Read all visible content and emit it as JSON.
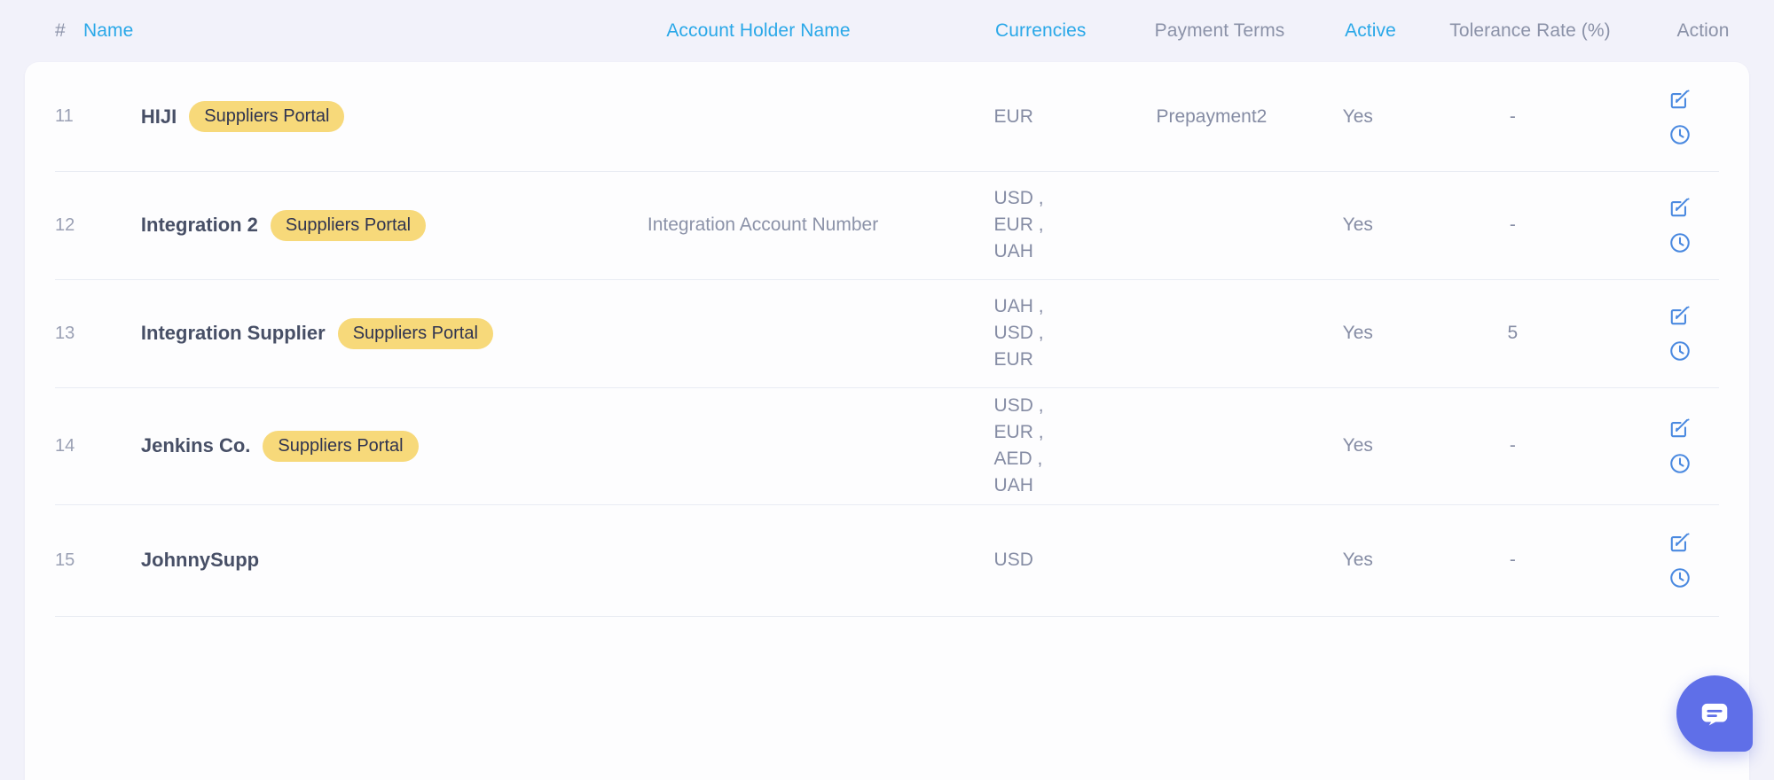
{
  "table": {
    "columns": [
      {
        "key": "num",
        "label": "#",
        "sortable": false
      },
      {
        "key": "name",
        "label": "Name",
        "sortable": true
      },
      {
        "key": "holder",
        "label": "Account Holder Name",
        "sortable": true
      },
      {
        "key": "curr",
        "label": "Currencies",
        "sortable": true
      },
      {
        "key": "terms",
        "label": "Payment Terms",
        "sortable": false
      },
      {
        "key": "active",
        "label": "Active",
        "sortable": true
      },
      {
        "key": "tol",
        "label": "Tolerance Rate (%)",
        "sortable": false
      },
      {
        "key": "action",
        "label": "Action",
        "sortable": false
      }
    ],
    "rows": [
      {
        "num": "11",
        "name": "HIJI",
        "badge": "Suppliers Portal",
        "holder": "",
        "currencies": "EUR",
        "terms": "Prepayment2",
        "active": "Yes",
        "tolerance": "-"
      },
      {
        "num": "12",
        "name": "Integration 2",
        "badge": "Suppliers Portal",
        "holder": "Integration Account Number",
        "currencies": "USD ,\nEUR ,\nUAH",
        "terms": "",
        "active": "Yes",
        "tolerance": "-"
      },
      {
        "num": "13",
        "name": "Integration Supplier",
        "badge": "Suppliers Portal",
        "holder": "",
        "currencies": "UAH ,\nUSD ,\nEUR",
        "terms": "",
        "active": "Yes",
        "tolerance": "5"
      },
      {
        "num": "14",
        "name": "Jenkins Co.",
        "badge": "Suppliers Portal",
        "holder": "",
        "currencies": "USD ,\nEUR ,\nAED ,\nUAH",
        "terms": "",
        "active": "Yes",
        "tolerance": "-"
      },
      {
        "num": "15",
        "name": "JohnnySupp",
        "badge": "",
        "holder": "",
        "currencies": "USD",
        "terms": "",
        "active": "Yes",
        "tolerance": "-"
      }
    ],
    "action_icons": [
      {
        "name": "edit-icon",
        "title": "Edit"
      },
      {
        "name": "history-clock-icon",
        "title": "History"
      }
    ]
  },
  "chat": {
    "icon": "chat-bubble-icon",
    "label": "Open chat"
  },
  "colors": {
    "sortable_header": "#2aa8e8",
    "plain_header": "#8b92a8",
    "badge_bg": "#f7d97a",
    "badge_text": "#2f3350",
    "icon_blue": "#4a89e0",
    "chat_bg": "#5f6fe8",
    "page_bg": "#f2f2fa",
    "card_bg": "#fdfdfe",
    "row_divider": "#e9ecf3",
    "name_text": "#474f66",
    "cell_text": "#858ca4"
  }
}
